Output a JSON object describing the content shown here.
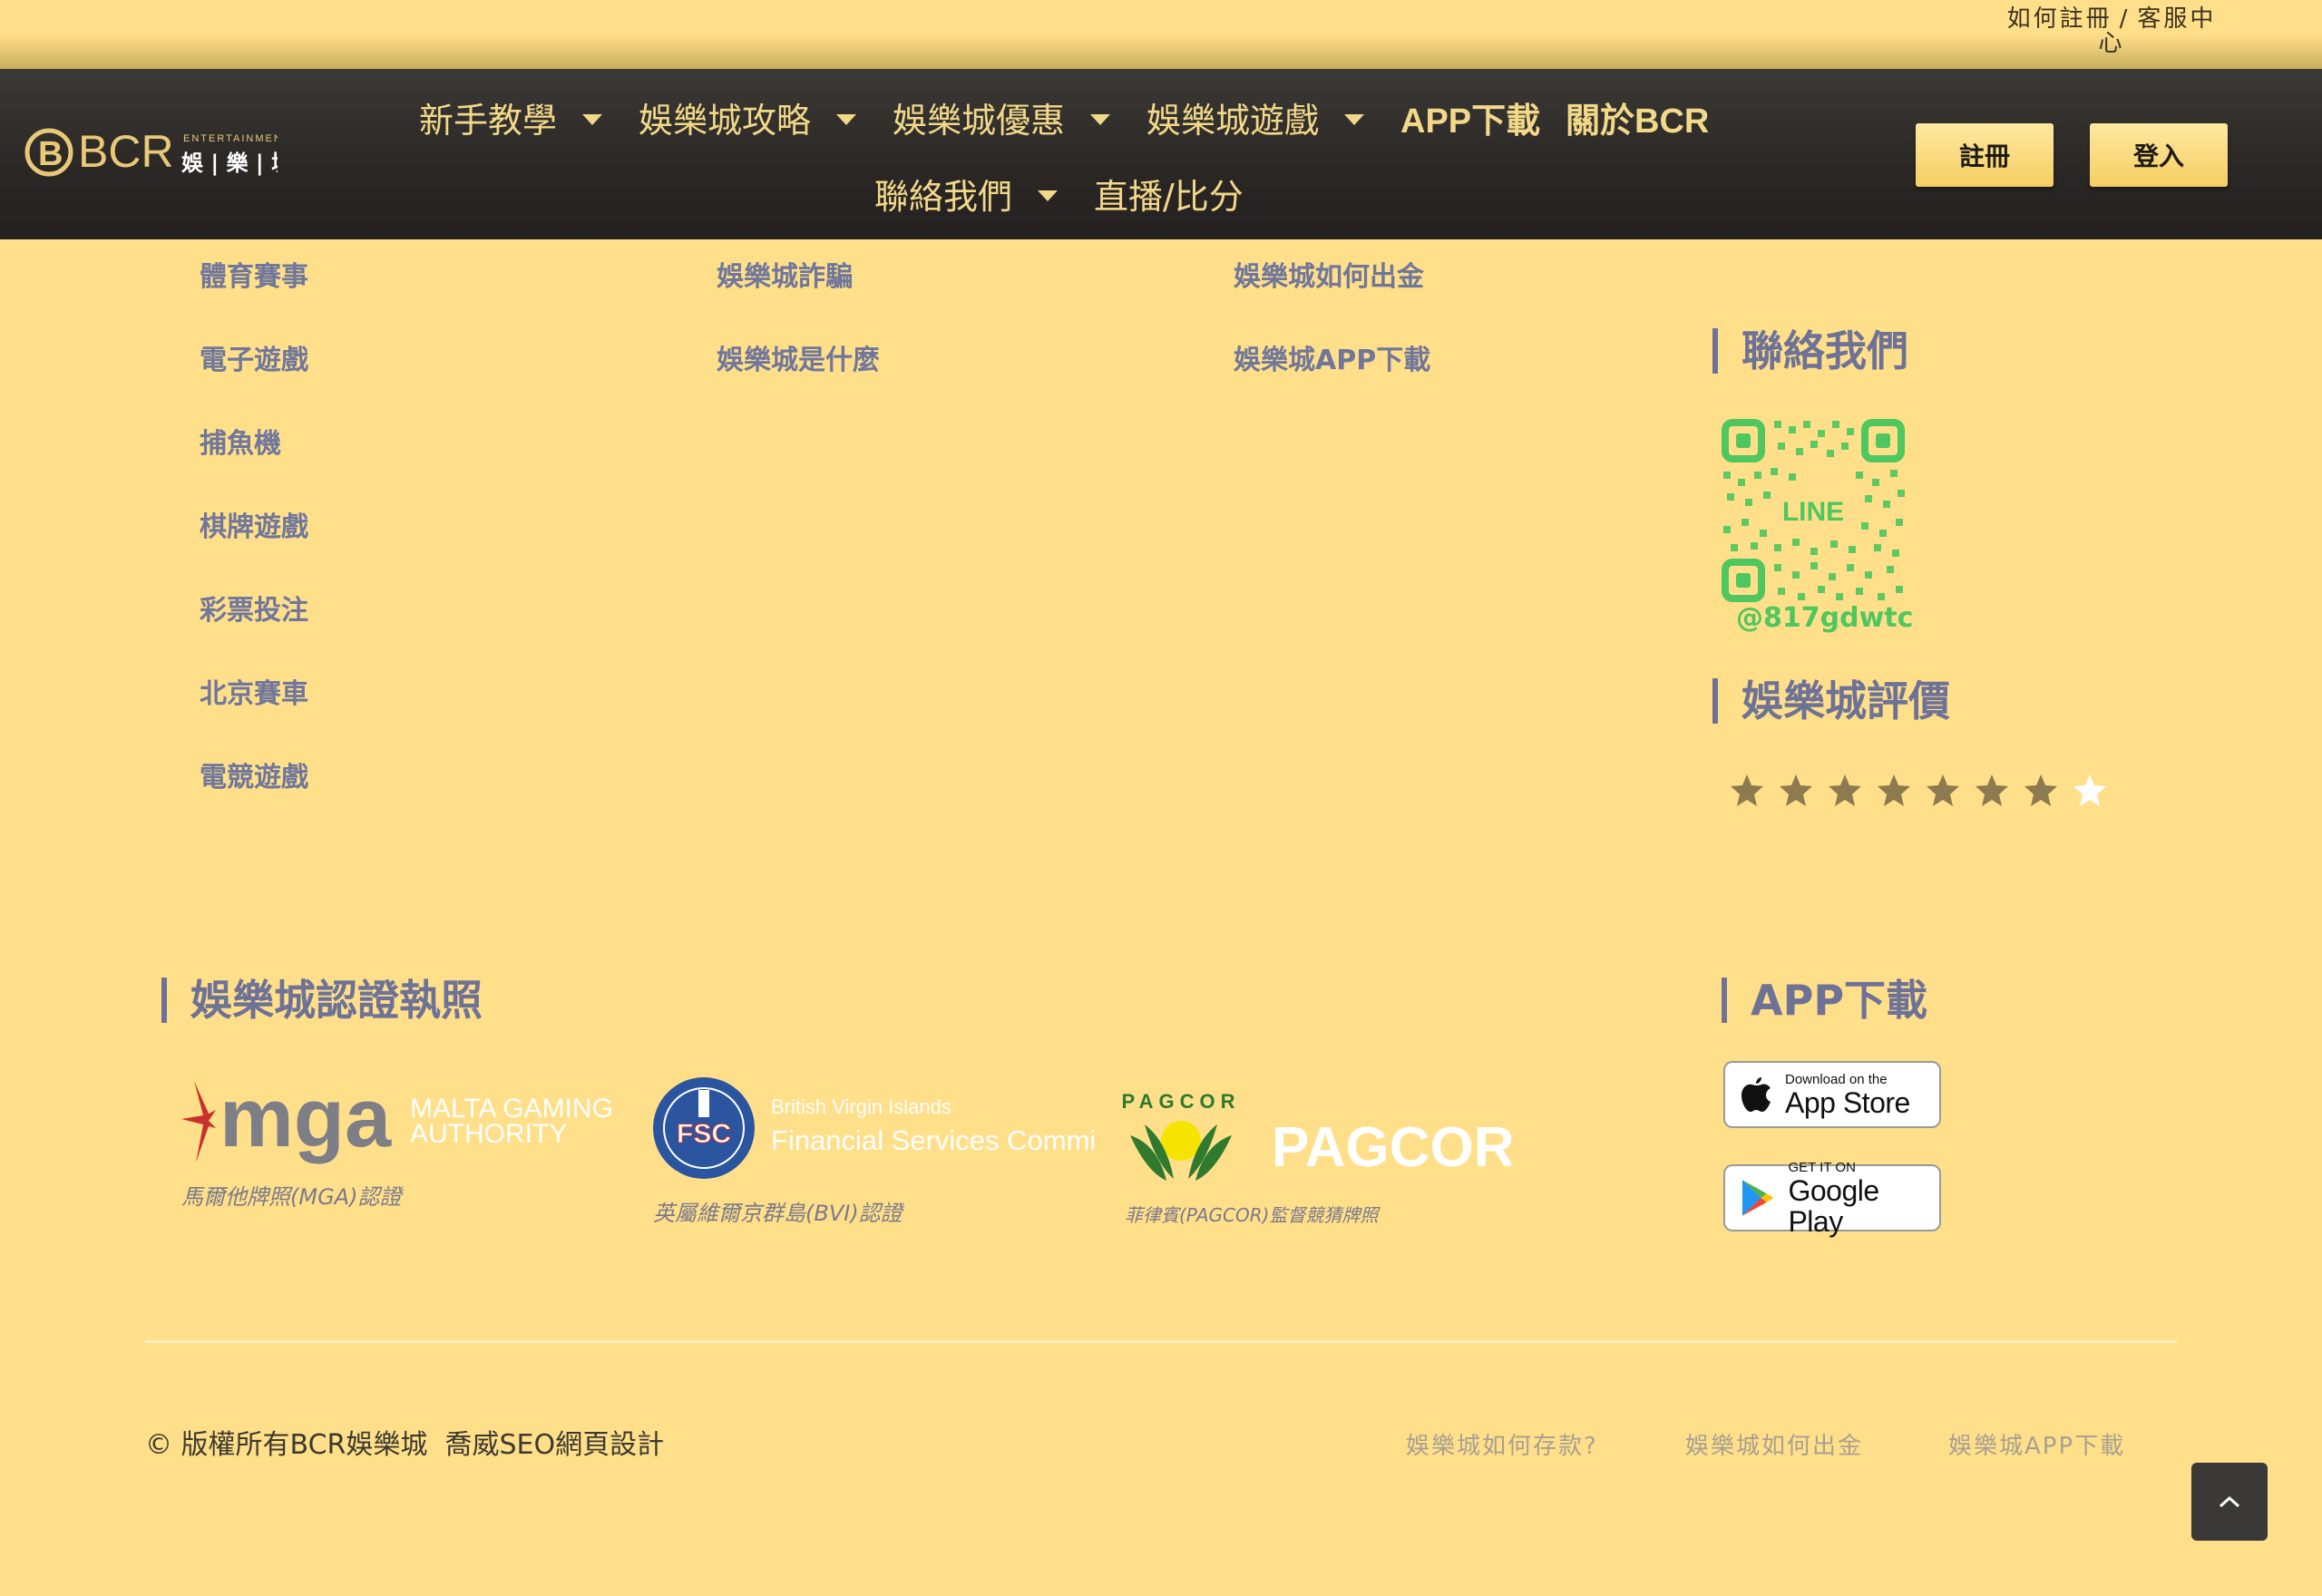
{
  "topbar": {
    "register_help": "如何註冊",
    "separator": "/",
    "customer_service": "客服中心"
  },
  "header": {
    "logo": {
      "brand": "BCR",
      "sub": "ENTERTAINMENT",
      "cn": "娛 | 樂 | 城",
      "icon": "bcr-logo-icon"
    },
    "nav": [
      {
        "label": "新手教學",
        "has_dropdown": true
      },
      {
        "label": "娛樂城攻略",
        "has_dropdown": true
      },
      {
        "label": "娛樂城優惠",
        "has_dropdown": true
      },
      {
        "label": "娛樂城遊戲",
        "has_dropdown": true
      },
      {
        "label": "APP下載",
        "has_dropdown": false
      },
      {
        "label": "關於BCR",
        "has_dropdown": false
      },
      {
        "label": "聯絡我們",
        "has_dropdown": true
      },
      {
        "label": "直播/比分",
        "has_dropdown": false
      }
    ],
    "register_button": "註冊",
    "login_button": "登入"
  },
  "columns": {
    "games": [
      "體育賽事",
      "電子遊戲",
      "捕魚機",
      "棋牌遊戲",
      "彩票投注",
      "北京賽車",
      "電競遊戲"
    ],
    "guides": [
      "娛樂城詐騙",
      "娛樂城是什麼"
    ],
    "help": [
      "娛樂城如何出金",
      "娛樂城APP下載"
    ]
  },
  "contact": {
    "heading": "聯絡我們",
    "qr_label": "LINE",
    "line_id": "@817gdwtc"
  },
  "rating": {
    "heading": "娛樂城評價",
    "stars_total": 8,
    "stars_filled": 7,
    "filled_color": "#8D7A4F",
    "empty_color": "#FFFFFF"
  },
  "licenses": {
    "heading": "娛樂城認證執照",
    "items": [
      {
        "logo_text": "mga",
        "logo_sub_1": "MALTA GAMING",
        "logo_sub_2": "AUTHORITY",
        "caption": "馬爾他牌照(MGA)認證"
      },
      {
        "logo_text": "FSC",
        "logo_sub_1": "British Virgin Islands",
        "logo_sub_2": "Financial Services Commission",
        "caption": "英屬維爾京群島(BVI)認證"
      },
      {
        "logo_text": "PAGCOR",
        "logo_arc": "PAGCOR",
        "caption": "菲律賓(PAGCOR)監督競猜牌照"
      }
    ]
  },
  "app": {
    "heading": "APP下載",
    "app_store": {
      "small": "Download on the",
      "big": "App Store"
    },
    "google_play": {
      "small": "GET IT ON",
      "big": "Google Play"
    }
  },
  "footer": {
    "copyright": "© 版權所有BCR娛樂城",
    "designer": "喬威SEO網頁設計",
    "links": [
      "娛樂城如何存款?",
      "娛樂城如何出金",
      "娛樂城APP下載"
    ]
  },
  "colors": {
    "background": "#FFDF8A",
    "header": "#2A2725",
    "nav_text": "#F2D889",
    "link": "#70779B",
    "line_green": "#4DC75E"
  }
}
